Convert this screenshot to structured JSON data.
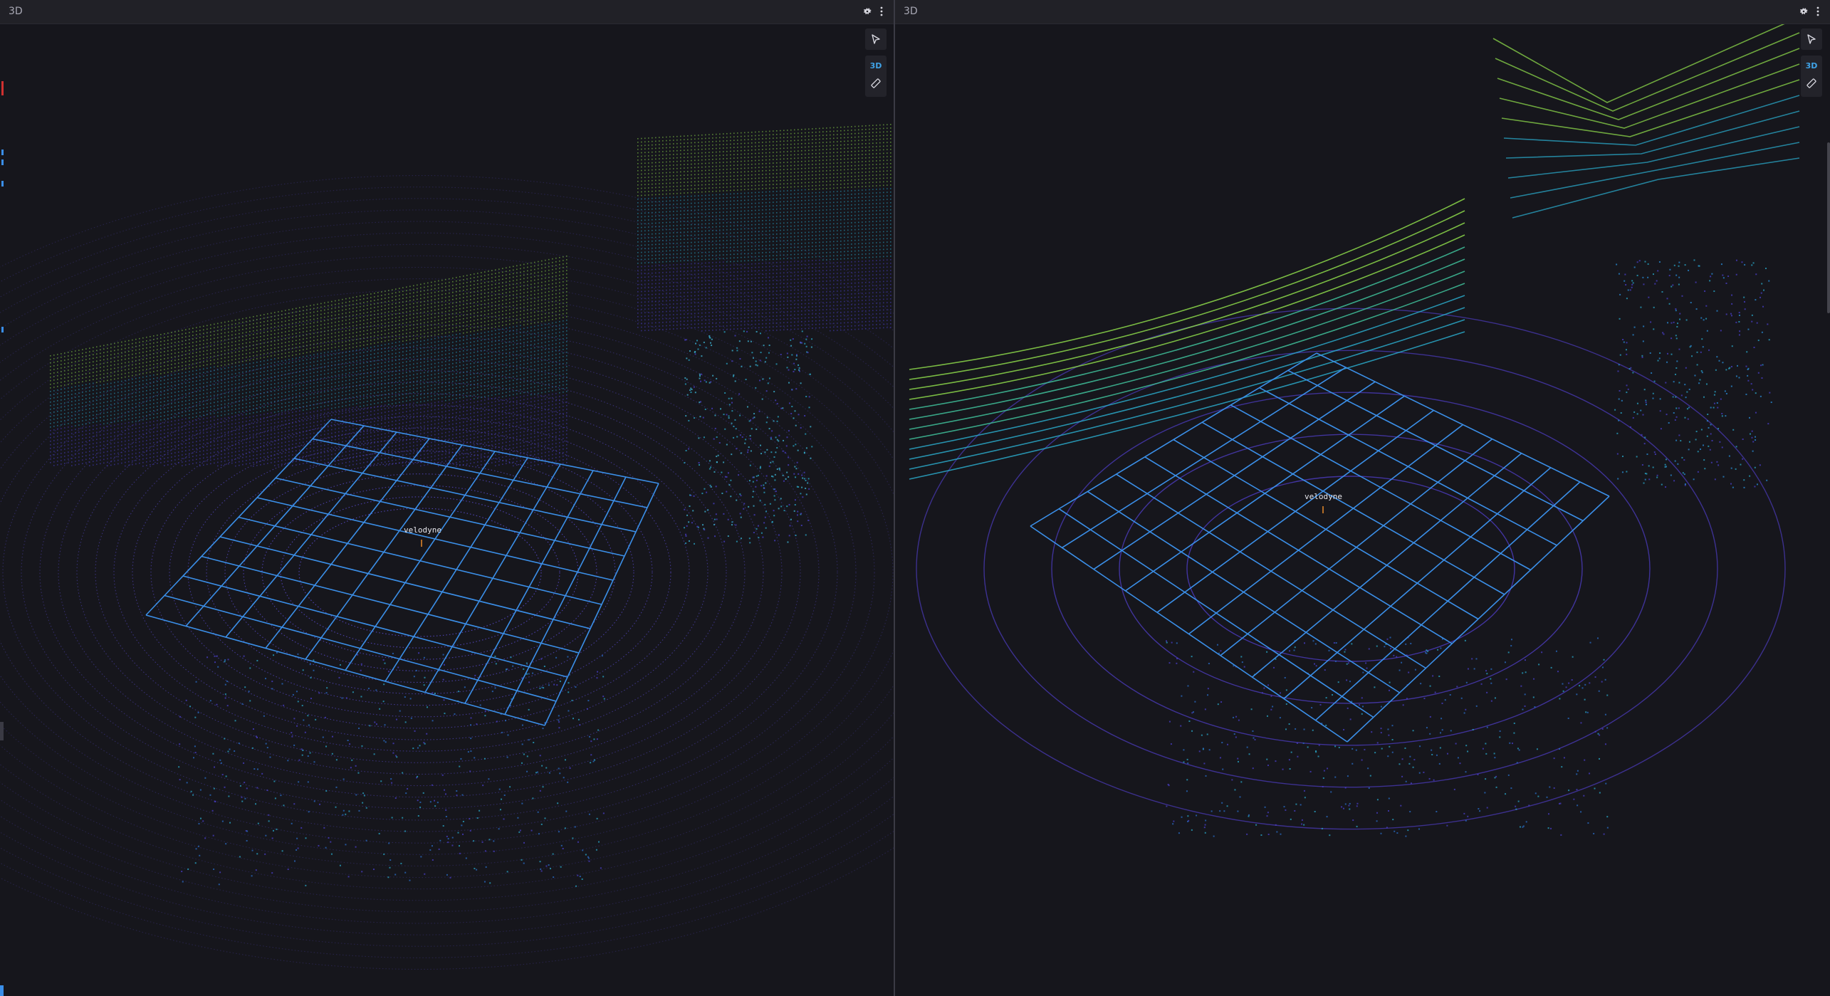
{
  "panels": [
    {
      "title": "3D",
      "view_mode": "3D",
      "frame_label": "velodyne",
      "icons": [
        "gear-icon",
        "more-vertical-icon",
        "select-cursor-icon",
        "ruler-icon"
      ]
    },
    {
      "title": "3D",
      "view_mode": "3D",
      "frame_label": "velodyne",
      "icons": [
        "gear-icon",
        "more-vertical-icon",
        "select-cursor-icon",
        "ruler-icon"
      ]
    }
  ],
  "colors": {
    "background": "#16161c",
    "titlebar": "#212127",
    "grid": "#3b8fe8",
    "accent": "#3fa3e8",
    "scan_ring": "#5a4bd0",
    "points_low": "#4a3fc8",
    "points_mid": "#2aa8c8",
    "points_high": "#8cd84a"
  }
}
